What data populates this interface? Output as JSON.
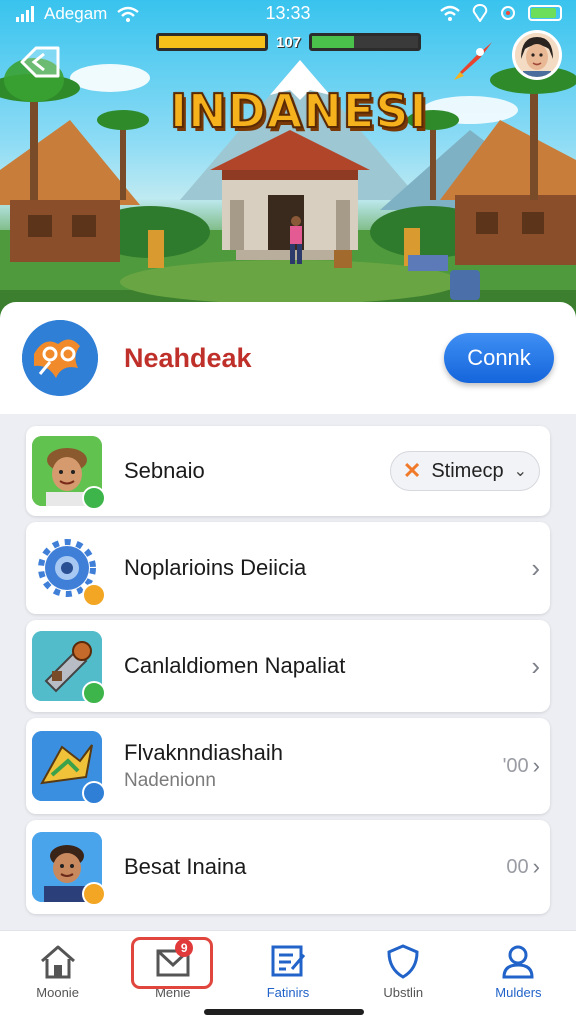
{
  "status_bar": {
    "carrier": "Adegam",
    "time": "13:33"
  },
  "hud": {
    "count": "107",
    "bar_left_fill": 1.0,
    "bar_right_fill": 0.4,
    "bar_left_color": "#f5c019",
    "bar_right_color": "#49c14a"
  },
  "game": {
    "title": "INDANESI"
  },
  "header": {
    "brand": "Neahdeak",
    "connect_label": "Connk"
  },
  "list": {
    "items": [
      {
        "title": "Sebnaio",
        "pill_label": "Stimecp",
        "badge_color": "#3db54a"
      },
      {
        "title": "Noplarioins Deiicia",
        "badge_color": "#f2a623"
      },
      {
        "title": "Canlaldiomen Napaliat",
        "badge_color": "#3db54a"
      },
      {
        "title": "Flvaknndiashaih",
        "subtitle": "Nadenionn",
        "meta": "'00",
        "badge_color": "#2f7fd6"
      },
      {
        "title": "Besat Inaina",
        "meta": "00",
        "badge_color": "#f2a623"
      }
    ]
  },
  "nav": {
    "items": [
      {
        "label": "Moonie"
      },
      {
        "label": "Menie",
        "badge": "9"
      },
      {
        "label": "Fatinirs"
      },
      {
        "label": "Ubstlin"
      },
      {
        "label": "Mulders"
      }
    ]
  },
  "colors": {
    "brand_red": "#c0302a",
    "accent_blue": "#2163c9",
    "selected_outline": "#e0463d"
  }
}
